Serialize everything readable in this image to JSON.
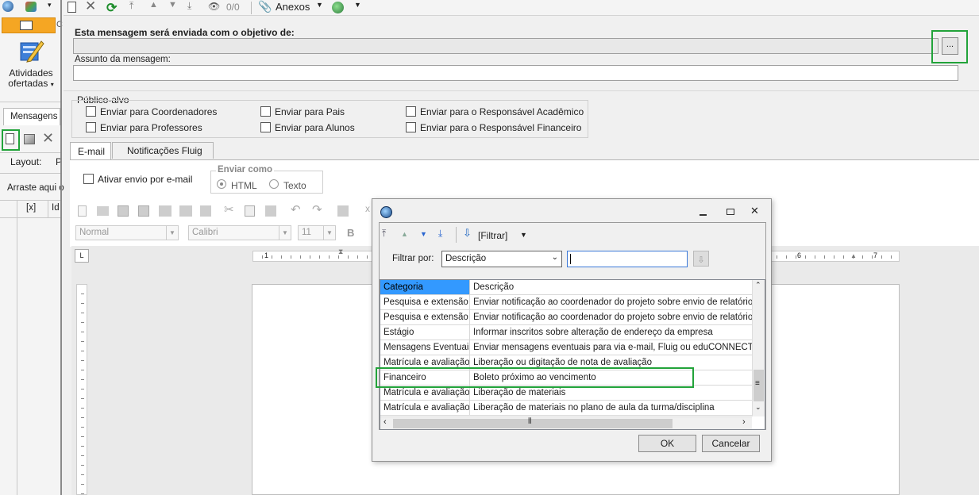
{
  "toolbar": {
    "anexos_label": "Anexos",
    "counter": "0/0"
  },
  "left_pane": {
    "activities_label_line1": "Atividades",
    "activities_label_line2": "ofertadas",
    "tab_label": "Mensagens -",
    "layout_label": "Layout:",
    "layout_extra": "P",
    "drag_hint": "Arraste aqui o",
    "col_x": "[x]",
    "col_id": "Id"
  },
  "form": {
    "objective_label": "Esta mensagem será enviada com o objetivo de:",
    "objective_button": "...",
    "subject_label": "Assunto da mensagem:",
    "audience_legend": "Público-alvo",
    "audience": [
      "Enviar para Coordenadores",
      "Enviar para Pais",
      "Enviar para o Responsável Acadêmico",
      "Enviar para Professores",
      "Enviar para Alunos",
      "Enviar para o Responsável Financeiro"
    ],
    "tabs": [
      "E-mail",
      "Notificações Fluig"
    ],
    "enable_email": "Ativar envio por e-mail",
    "send_as_legend": "Enviar como",
    "send_as_html": "HTML",
    "send_as_text": "Texto",
    "style_select": "Normal",
    "font_select": "Calibri",
    "size_select": "11",
    "bold": "B",
    "ruler_6": "6",
    "ruler_7": "7",
    "ruler_1": "1"
  },
  "dialog": {
    "filter_button": "[Filtrar]",
    "filter_by_label": "Filtrar por:",
    "filter_by_value": "Descrição",
    "filter_text": "",
    "columns": [
      "Categoria",
      "Descrição"
    ],
    "rows": [
      [
        "Pesquisa e extensão",
        "Enviar notificação ao coordenador do projeto sobre envio de relatório parci"
      ],
      [
        "Pesquisa e extensão",
        "Enviar notificação ao coordenador do projeto sobre envio de relatório final c"
      ],
      [
        "Estágio",
        "Informar inscritos sobre alteração de endereço da empresa"
      ],
      [
        "Mensagens Eventuais",
        "Enviar mensagens eventuais para via e-mail, Fluig ou eduCONNECT."
      ],
      [
        "Matrícula e avaliação",
        "Liberação ou digitação de nota de avaliação"
      ],
      [
        "Financeiro",
        "Boleto próximo ao vencimento"
      ],
      [
        "Matrícula e avaliação",
        "Liberação de materiais"
      ],
      [
        "Matrícula e avaliação",
        "Liberação de materiais no plano de aula da turma/disciplina"
      ]
    ],
    "ok": "OK",
    "cancel": "Cancelar"
  },
  "colors": {
    "highlight": "#22a33a",
    "header_selected": "#3399ff",
    "ribbon_orange": "#f5a623"
  }
}
